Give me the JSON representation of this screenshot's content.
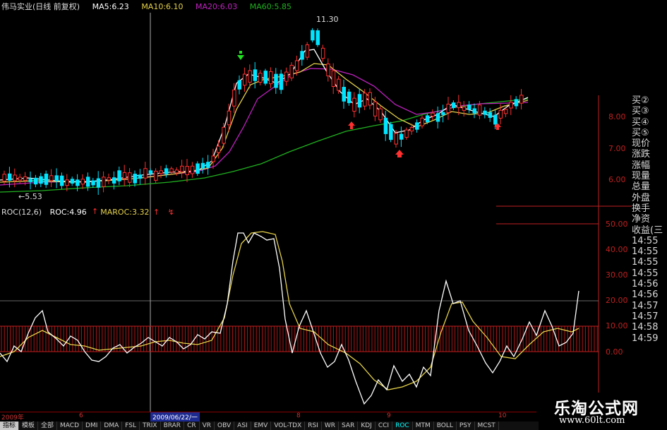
{
  "legend": {
    "title": "伟马实业(日线 前复权)",
    "ma5": "MA5:6.23",
    "ma10": "MA10:6.10",
    "ma20": "MA20:6.03",
    "ma60": "MA60:5.85"
  },
  "annotations": {
    "high": "11.30",
    "low": "←5.53"
  },
  "roc_legend": {
    "name": "ROC(12,6)",
    "roc": "ROC:4.96",
    "roc_arrow": "↑",
    "maroc": "MAROC:3.32",
    "maroc_arrow": "↑",
    "marker": "↯"
  },
  "price_axis": [
    "8.00",
    "7.00",
    "6.00"
  ],
  "roc_axis": [
    "50.00",
    "40.00",
    "30.00",
    "20.00",
    "10.00",
    "0.00"
  ],
  "right_panel": [
    "买②",
    "买③",
    "买④",
    "买⑤",
    "现价",
    "涨跌",
    "涨幅",
    "现量",
    "总量",
    "外盘",
    "换手",
    "净资",
    "收益(三",
    "14:55",
    "14:55",
    "14:55",
    "14:55",
    "14:56",
    "14:56",
    "14:57",
    "14:57",
    "14:58",
    "14:59"
  ],
  "date_strip": {
    "year": "2009年",
    "m6": "6",
    "selected": "2009/06/22/一",
    "m8": "8",
    "m9": "9",
    "m10": "10"
  },
  "tabs": [
    "指标",
    "模板",
    "全部",
    "MACD",
    "DMI",
    "DMA",
    "FSL",
    "TRIX",
    "BRAR",
    "CR",
    "VR",
    "OBV",
    "ASI",
    "EMV",
    "VOL-TDX",
    "RSI",
    "WR",
    "SAR",
    "KDJ",
    "CCI",
    "ROC",
    "MTM",
    "BOLL",
    "PSY",
    "MCST"
  ],
  "active_tab": "ROC",
  "watermark": {
    "cn": "乐淘公式网",
    "url": "www.60lt.com"
  },
  "colors": {
    "ma5": "#ffffff",
    "ma10": "#e6d24a",
    "ma20": "#c020c0",
    "ma60": "#20b020",
    "up": "#ff3030",
    "down": "#00ffff",
    "roc": "#ffffff",
    "maroc": "#e6d24a",
    "axis": "#c02020"
  }
}
